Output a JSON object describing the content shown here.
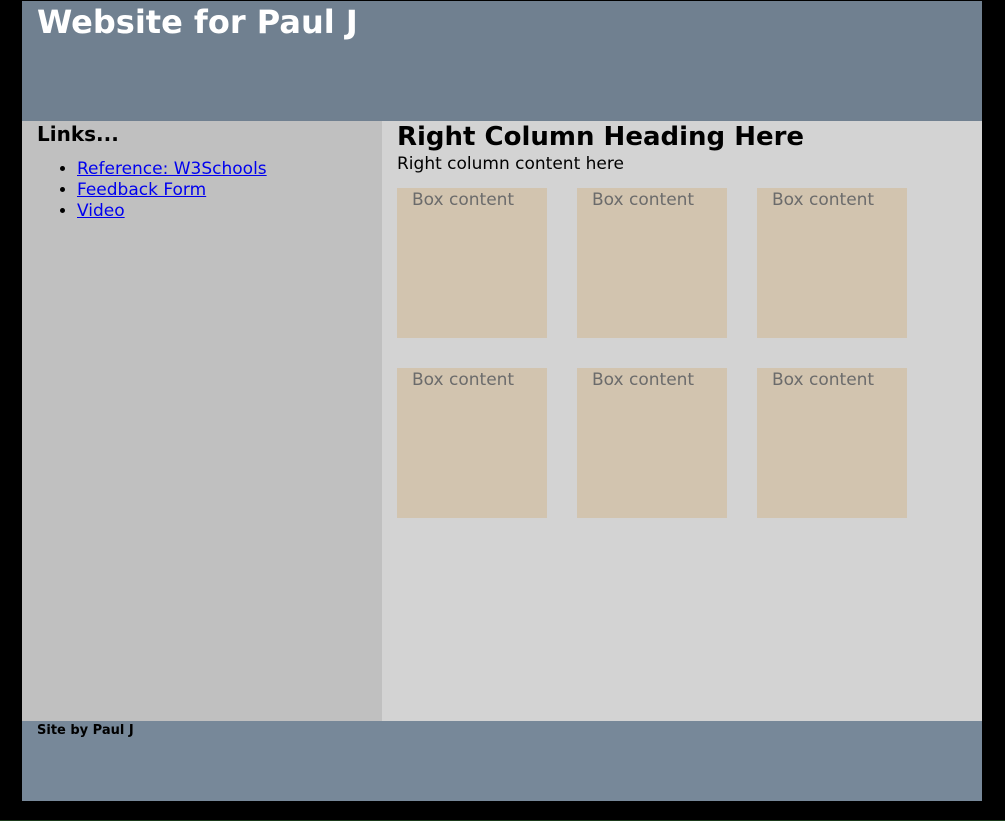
{
  "header": {
    "title": "Website for Paul J"
  },
  "sidebar": {
    "heading": "Links...",
    "links": [
      {
        "label": "Reference: W3Schools"
      },
      {
        "label": "Feedback Form"
      },
      {
        "label": "Video"
      }
    ]
  },
  "main": {
    "heading": "Right Column Heading Here",
    "text": "Right column content here",
    "boxes": [
      {
        "label": "Box content"
      },
      {
        "label": "Box content"
      },
      {
        "label": "Box content"
      },
      {
        "label": "Box content"
      },
      {
        "label": "Box content"
      },
      {
        "label": "Box content"
      }
    ]
  },
  "footer": {
    "text": "Site by Paul J"
  },
  "colors": {
    "header_bg": "#708090",
    "sidebar_bg": "#c0c0c0",
    "main_bg": "#d3d3d3",
    "box_bg": "#d2c4af",
    "footer_bg": "#778899",
    "link": "#0000ee"
  }
}
